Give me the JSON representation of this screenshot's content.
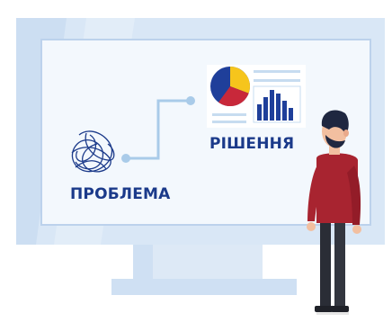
{
  "labels": {
    "problem": "ПРОБЛЕМА",
    "solution": "РІШЕННЯ"
  },
  "colors": {
    "accent": "#1b3a8a",
    "bar_blue": "#1f3f9a",
    "pie_yellow": "#f6c51c",
    "pie_red": "#c8283a",
    "shirt": "#a82430"
  }
}
